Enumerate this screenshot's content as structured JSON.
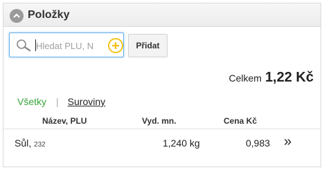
{
  "panel": {
    "title": "Položky",
    "collapse_icon": "chevron-up-icon"
  },
  "search": {
    "placeholder": "Hledat PLU, N",
    "icon": "search-icon",
    "add_icon": "plus-circle-icon",
    "add_button_label": "Přidat"
  },
  "summary": {
    "total_label": "Celkem",
    "total_value": "1,22 Kč"
  },
  "filters": {
    "all_label": "Všetky",
    "separator": "|",
    "raw_label": "Suroviny",
    "active_color": "#3aa63a"
  },
  "table": {
    "columns": [
      "Název, PLU",
      "Vyd. mn.",
      "Cena Kč"
    ],
    "rows": [
      {
        "name": "Sůl,",
        "plu": "232",
        "quantity": "1,240 kg",
        "price": "0,983",
        "arrow": "»"
      }
    ]
  }
}
